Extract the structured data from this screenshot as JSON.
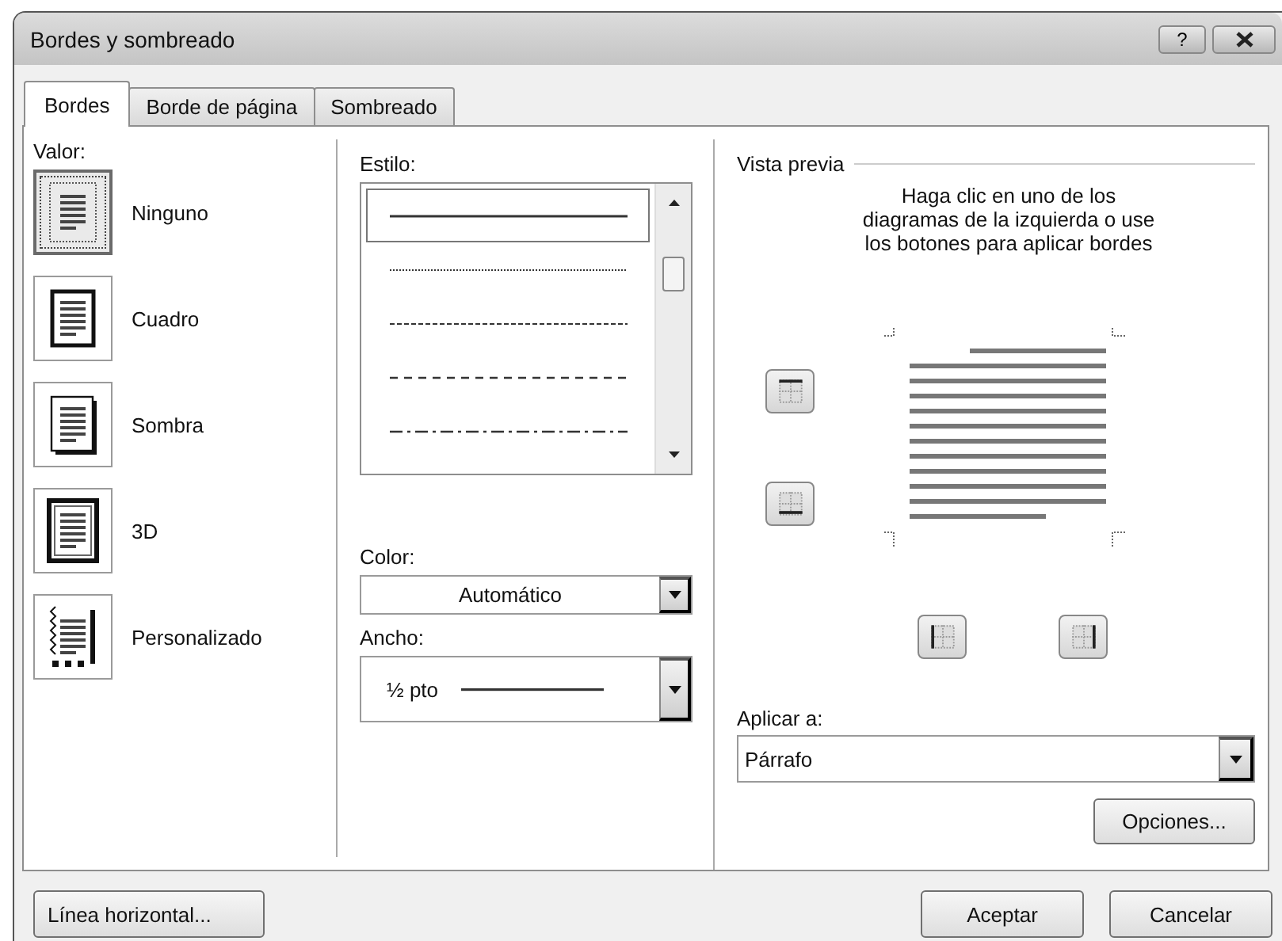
{
  "window": {
    "title": "Bordes y sombreado",
    "help_button": "?"
  },
  "tabs": [
    {
      "label": "Bordes",
      "selected": true
    },
    {
      "label": "Borde de página",
      "selected": false
    },
    {
      "label": "Sombreado",
      "selected": false
    }
  ],
  "settings": {
    "label": "Valor:",
    "items": [
      {
        "label": "Ninguno",
        "kind": "none",
        "selected": true
      },
      {
        "label": "Cuadro",
        "kind": "box",
        "selected": false
      },
      {
        "label": "Sombra",
        "kind": "shadow",
        "selected": false
      },
      {
        "label": "3D",
        "kind": "three-d",
        "selected": false
      },
      {
        "label": "Personalizado",
        "kind": "custom",
        "selected": false
      }
    ]
  },
  "style": {
    "label": "Estilo:",
    "items": [
      {
        "kind": "solid",
        "selected": true
      },
      {
        "kind": "dotted",
        "selected": false
      },
      {
        "kind": "dashed",
        "selected": false
      },
      {
        "kind": "long-dash",
        "selected": false
      },
      {
        "kind": "dash-dot",
        "selected": false
      }
    ]
  },
  "color": {
    "label": "Color:",
    "value": "Automático"
  },
  "width": {
    "label": "Ancho:",
    "value": "½ pto"
  },
  "preview": {
    "title": "Vista previa",
    "hint": "Haga clic en uno de los\ndiagramas de la izquierda o use\nlos botones para aplicar bordes"
  },
  "apply_to": {
    "label": "Aplicar a:",
    "value": "Párrafo"
  },
  "options_button": "Opciones...",
  "footer": {
    "left_button": "Línea horizontal...",
    "buttons": [
      "Aceptar",
      "Cancelar"
    ]
  }
}
